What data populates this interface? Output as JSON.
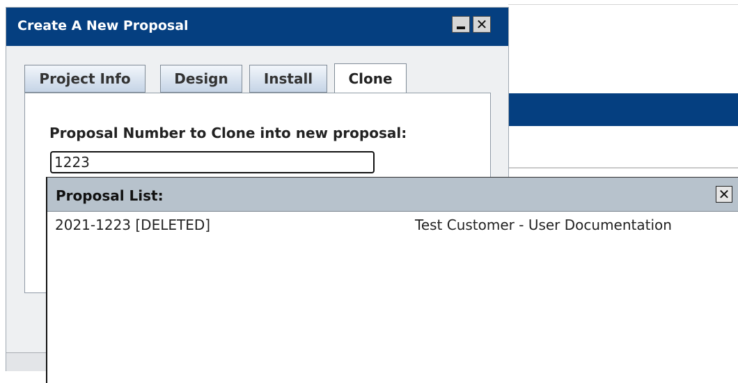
{
  "dialog": {
    "title": "Create A New Proposal",
    "minimize_icon": "minimize-icon",
    "close_icon": "close-icon",
    "tabs": [
      {
        "label": "Project Info",
        "active": false
      },
      {
        "label": "Design",
        "active": false
      },
      {
        "label": "Install",
        "active": false
      },
      {
        "label": "Clone",
        "active": true
      }
    ],
    "clone": {
      "label": "Proposal Number to Clone into new proposal:",
      "value": "1223"
    }
  },
  "popup": {
    "title": "Proposal List:",
    "close_icon": "close-icon",
    "rows": [
      {
        "id": "2021-1223 [DELETED]",
        "description": "Test Customer - User Documentation"
      }
    ]
  },
  "colors": {
    "title_bar": "#053f80",
    "popup_header": "#b7c2cc",
    "dialog_body": "#eef0f2"
  }
}
